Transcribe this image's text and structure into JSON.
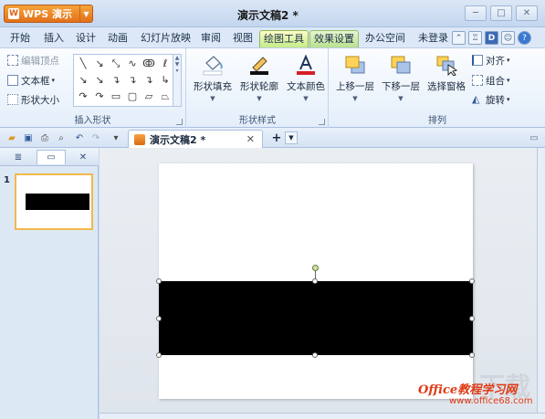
{
  "titlebar": {
    "app_name": "WPS 演示",
    "app_logo": "W",
    "doc_title": "演示文稿2 *",
    "controls": [
      "─",
      "□",
      "✕"
    ]
  },
  "menu_tabs": [
    "开始",
    "插入",
    "设计",
    "动画",
    "幻灯片放映",
    "审阅",
    "视图",
    "绘图工具",
    "效果设置",
    "办公空间"
  ],
  "active_tab": "绘图工具",
  "user_status": "未登录",
  "ribbon": {
    "insert_shapes": {
      "label": "插入形状",
      "edit_points": "编辑顶点",
      "text_box": "文本框",
      "shape_size": "形状大小"
    },
    "shape_styles": {
      "label": "形状样式",
      "fill": "形状填充",
      "outline": "形状轮廓",
      "text_color": "文本颜色"
    },
    "arrange": {
      "label": "排列",
      "bring_forward": "上移一层",
      "send_backward": "下移一层",
      "selection_pane": "选择窗格",
      "align": "对齐",
      "group": "组合",
      "rotate": "旋转"
    }
  },
  "doc_tab": {
    "title": "演示文稿2 *",
    "add": "+"
  },
  "left_panel": {
    "slide_number": "1"
  },
  "watermark": {
    "brand": "Office教程学习网",
    "url": "www.office68.com"
  },
  "colors": {
    "active_tab": "#c6eb8a",
    "app_button": "#e2711a",
    "selected_slide_border": "#f2b84b",
    "shape_fill": "#000000"
  }
}
